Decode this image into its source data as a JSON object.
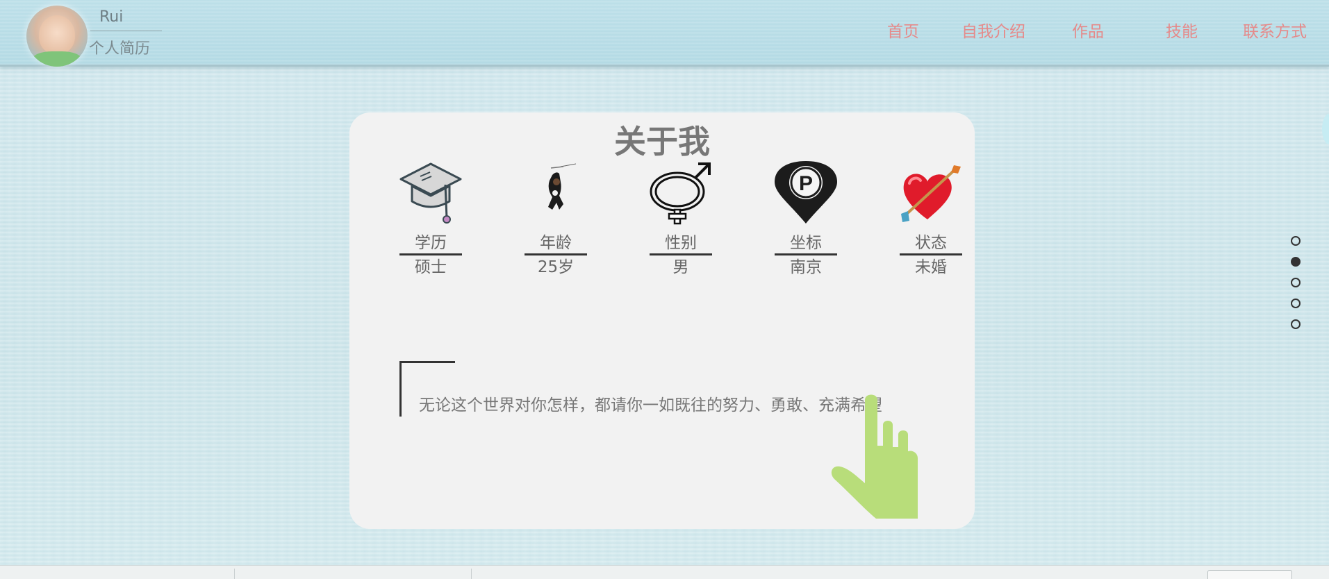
{
  "header": {
    "name": "Rui",
    "subtitle": "个人简历",
    "nav": [
      {
        "label": "首页",
        "id": "home"
      },
      {
        "label": "自我介绍",
        "id": "about"
      },
      {
        "label": "作品",
        "id": "works"
      },
      {
        "label": "技能",
        "id": "skills"
      },
      {
        "label": "联系方式",
        "id": "contact"
      }
    ]
  },
  "card": {
    "title": "关于我",
    "items": [
      {
        "label": "学历",
        "value": "硕士",
        "icon": "graduation-cap-icon"
      },
      {
        "label": "年龄",
        "value": "25岁",
        "icon": "climber-icon"
      },
      {
        "label": "性别",
        "value": "男",
        "icon": "gender-symbol-icon"
      },
      {
        "label": "坐标",
        "value": "南京",
        "icon": "location-pin-icon"
      },
      {
        "label": "状态",
        "value": "未婚",
        "icon": "heart-arrow-icon"
      }
    ],
    "quote": "无论这个世界对你怎样，都请你一如既往的努力、勇敢、充满希望"
  },
  "side_nav": {
    "count": 5,
    "active_index": 1
  },
  "colors": {
    "nav_text": "#e58a8a",
    "card_bg": "#f2f2f2",
    "hand": "#b8dd7a",
    "page_bg": "#cfe6eb"
  }
}
